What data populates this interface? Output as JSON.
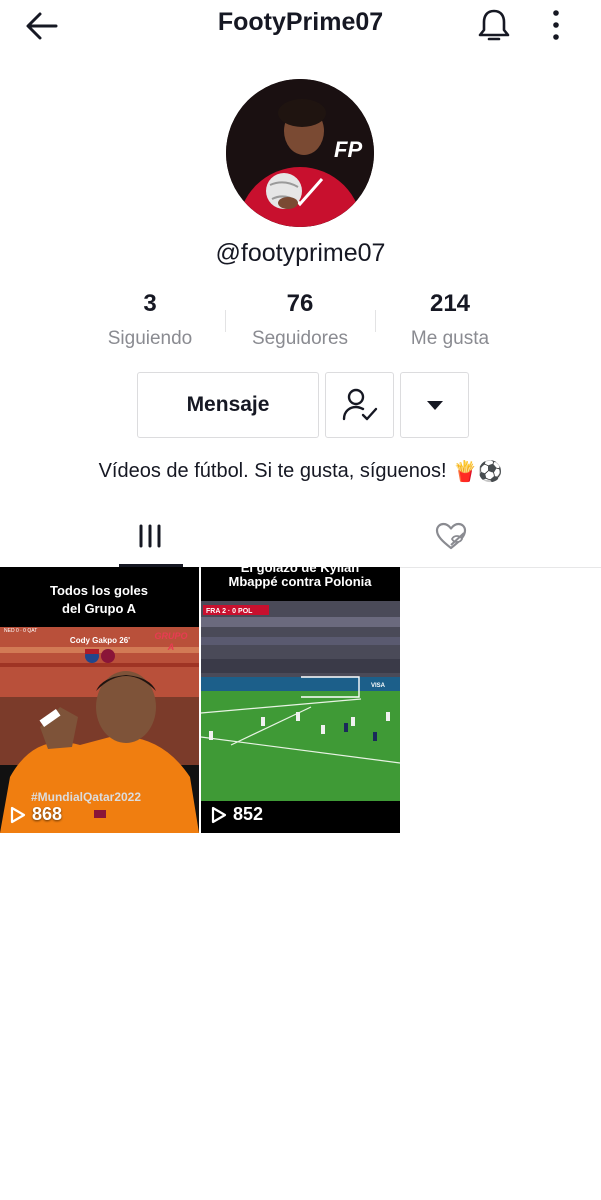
{
  "header": {
    "title": "FootyPrime07",
    "back_icon": "arrow-left-icon",
    "bell_icon": "bell-icon",
    "more_icon": "more-vertical-icon"
  },
  "profile": {
    "avatar_badge": "FP",
    "username": "@footyprime07",
    "stats": [
      {
        "value": "3",
        "label": "Siguiendo"
      },
      {
        "value": "76",
        "label": "Seguidores"
      },
      {
        "value": "214",
        "label": "Me gusta"
      }
    ],
    "bio": "Vídeos de fútbol. Si te gusta, síguenos!",
    "bio_emojis": "🍟⚽"
  },
  "actions": {
    "message_label": "Mensaje",
    "follow_icon": "user-check-icon",
    "dropdown_icon": "caret-down-icon"
  },
  "tabs": [
    {
      "name": "videos",
      "icon": "grid-icon",
      "active": true
    },
    {
      "name": "liked",
      "icon": "heart-hidden-icon",
      "active": false
    }
  ],
  "videos": [
    {
      "title_line1": "Todos los goles",
      "title_line2": "del Grupo A",
      "scoreboard": "NED 0 · 0 QAT",
      "player_tag": "Cody Gakpo 26'",
      "badge_line1": "GRUPO",
      "badge_line2": "A",
      "hashtag": "#MundialQatar2022",
      "views": "868"
    },
    {
      "title_line1": "El golazo de Kylian",
      "title_line2": "Mbappé contra Polonia",
      "scoreboard": "FRA 2 · 0 POL",
      "sponsor": "VISA",
      "views": "852"
    }
  ],
  "colors": {
    "text_primary": "#161823",
    "text_secondary": "#8a8b91",
    "border": "#dcdcde",
    "avatar_shirt": "#c8102e",
    "pitch_green": "#3f9a36"
  }
}
